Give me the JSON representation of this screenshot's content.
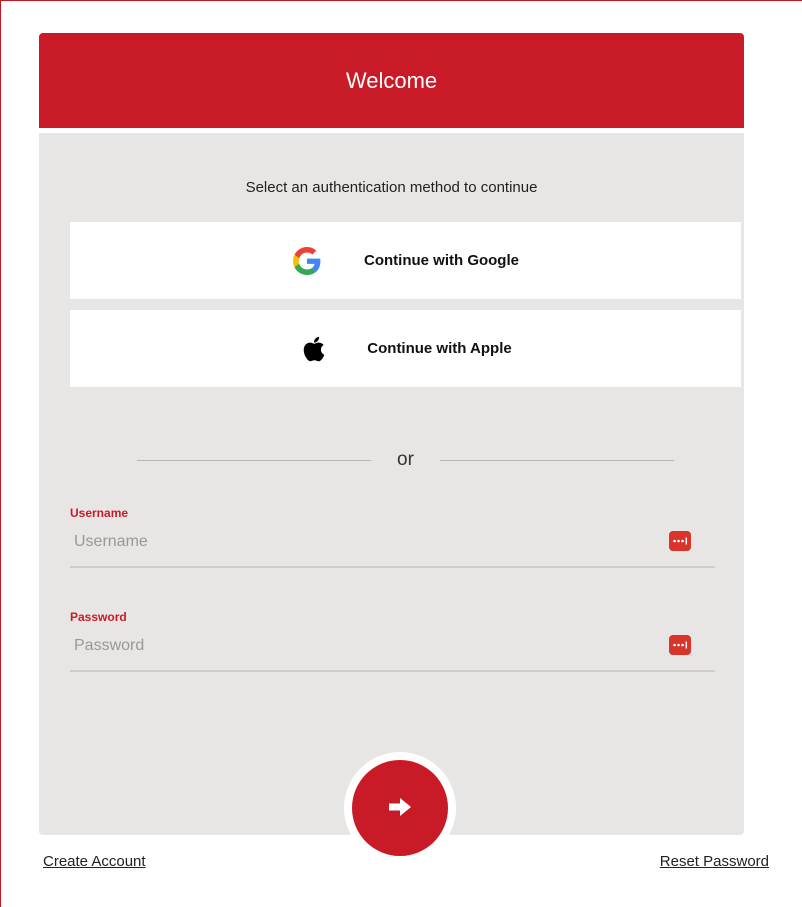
{
  "header": {
    "title": "Welcome"
  },
  "auth": {
    "instruction": "Select an authentication method to continue",
    "google_label": "Continue with Google",
    "apple_label": "Continue with Apple",
    "divider_text": "or"
  },
  "form": {
    "username": {
      "label": "Username",
      "placeholder": "Username",
      "value": ""
    },
    "password": {
      "label": "Password",
      "placeholder": "Password",
      "value": ""
    }
  },
  "footer": {
    "create_account": "Create Account",
    "reset_password": "Reset Password"
  },
  "colors": {
    "brand_red": "#c91a28",
    "panel_gray": "#e8e6e4",
    "password_manager_icon": "#d9342b"
  },
  "icons": {
    "google": "google-logo-icon",
    "apple": "apple-logo-icon",
    "password_manager": "password-manager-icon",
    "submit": "arrow-right-icon"
  }
}
